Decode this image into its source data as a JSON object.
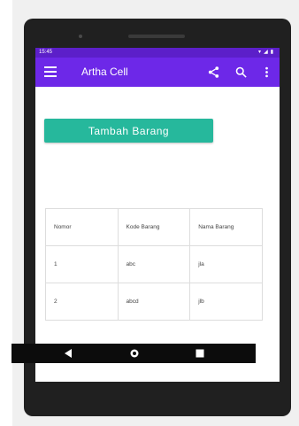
{
  "statusbar": {
    "time": "15:45",
    "icons": [
      "wifi-icon",
      "signal-icon",
      "battery-icon"
    ]
  },
  "appbar": {
    "title": "Artha Cell",
    "background": "#6d28e8",
    "actions": [
      "share-icon",
      "search-icon",
      "more-vert-icon"
    ]
  },
  "main": {
    "add_button_label": "Tambah Barang",
    "add_button_color": "#26b89c"
  },
  "table": {
    "headers": [
      "Nomor",
      "Kode Barang",
      "Nama Barang"
    ],
    "rows": [
      [
        "1",
        "abc",
        "jla"
      ],
      [
        "2",
        "abcd",
        "jlb"
      ]
    ]
  },
  "navbar": {
    "buttons": [
      "back-icon",
      "home-icon",
      "recents-icon"
    ]
  }
}
